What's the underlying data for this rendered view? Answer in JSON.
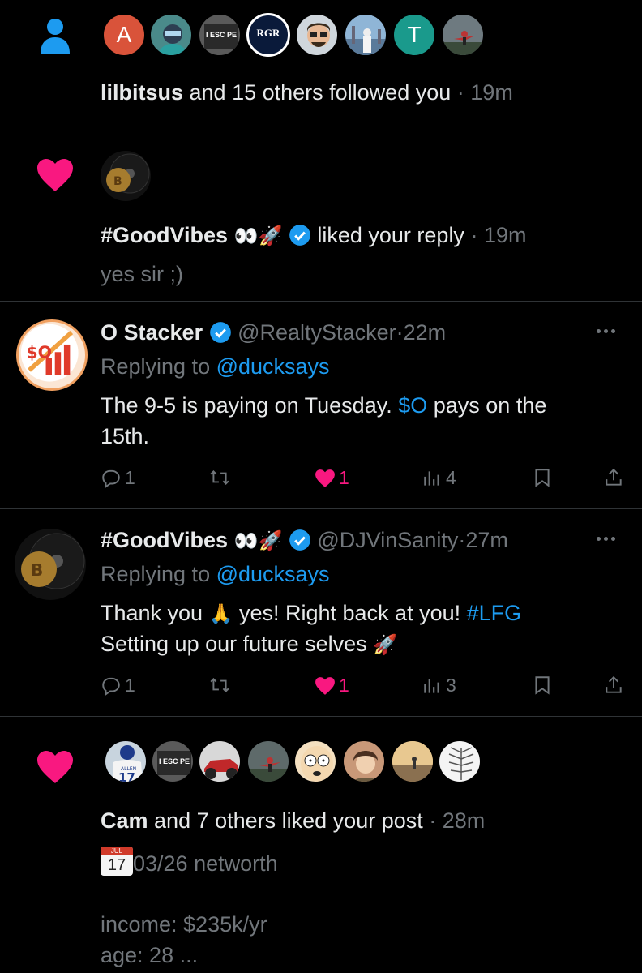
{
  "follow_notification": {
    "text_user": "lilbitsus",
    "text_rest": " and 15 others followed you",
    "time": "19m",
    "avatar_letters": [
      "A",
      "T"
    ],
    "avatar_escape": "I ESC PE",
    "avatar_rgr": "RGR"
  },
  "like_reply_notification": {
    "user_name": "#GoodVibes",
    "emoji": "👀🚀",
    "action": "liked your reply",
    "time": "19m",
    "quoted": "yes sir ;)"
  },
  "post1": {
    "name": "O Stacker",
    "handle": "@RealtyStacker",
    "time": "22m",
    "replying_prefix": "Replying to ",
    "replying_handle": "@ducksays",
    "text_part1": "The 9-5 is paying on Tuesday. ",
    "text_cashtag": "$O",
    "text_part2": " pays on the",
    "text_line2": "15th.",
    "avatar_label": "$O",
    "replies": "1",
    "likes": "1",
    "views": "4"
  },
  "post2": {
    "name": "#GoodVibes",
    "emoji": "👀🚀",
    "handle": "@DJVinSanity",
    "time": "27m",
    "replying_prefix": "Replying to ",
    "replying_handle": "@ducksays",
    "text_part1": "Thank you ",
    "text_emoji": "🙏",
    "text_part2": " yes! Right back at you! ",
    "text_hashtag": "#LFG",
    "text_line2": "Setting up our future selves ",
    "text_line2_emoji": "🚀",
    "replies": "1",
    "likes": "1",
    "views": "3"
  },
  "like_post_notification": {
    "text_user": "Cam",
    "text_rest": " and 7 others liked your post",
    "time": "28m",
    "calendar_month": "JUL",
    "calendar_day": "17",
    "post_title": "03/26 networth",
    "post_line1": "income: $235k/yr",
    "post_line2": "age: 28",
    "ellipsis": "...",
    "jersey_name": "ALLEN",
    "jersey_number": "17",
    "avatar_escape": "I ESC PE"
  },
  "dot_separator": "·",
  "colors": {
    "background": "#000000",
    "text": "#e7e9ea",
    "secondary": "#71767b",
    "accent_blue": "#1d9bf0",
    "like_pink": "#f91880",
    "divider": "#2f3336"
  }
}
